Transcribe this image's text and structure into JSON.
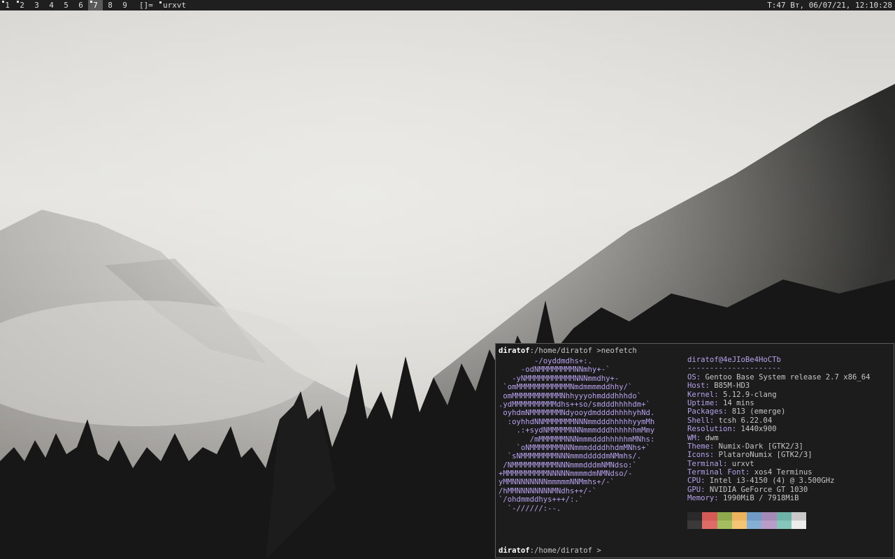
{
  "topbar": {
    "workspaces": [
      {
        "label": "1",
        "active": false,
        "occupied": true
      },
      {
        "label": "2",
        "active": false,
        "occupied": true
      },
      {
        "label": "3",
        "active": false,
        "occupied": false
      },
      {
        "label": "4",
        "active": false,
        "occupied": false
      },
      {
        "label": "5",
        "active": false,
        "occupied": false
      },
      {
        "label": "6",
        "active": false,
        "occupied": false
      },
      {
        "label": "7",
        "active": true,
        "occupied": true
      },
      {
        "label": "8",
        "active": false,
        "occupied": false
      },
      {
        "label": "9",
        "active": false,
        "occupied": false
      }
    ],
    "layout_symbol": "[]=",
    "window_title": "urxvt",
    "status": "T:47 Вт, 06/07/21, 12:10:28"
  },
  "terminal": {
    "prompt_user": "diratof",
    "prompt_path": ":/home/diratof >",
    "command": "neofetch",
    "logo_lines": [
      "        -/oyddmdhs+:.",
      "     -odNMMMMMMMMNNmhy+-`",
      "   -yNMMMMMMMMMMMNNNmmdhy+-",
      " `omMMMMMMMMMMMMNmdmmmmddhhy/`",
      " omMMMMMMMMMMMNhhyyyohmdddhhhdo`",
      ".ydMMMMMMMMMMdhs++so/smdddhhhhdm+`",
      " oyhdmNMMMMMMMNdyooydmddddhhhhyhNd.",
      "  :oyhhdNNMMMMMMMNNNmmdddhhhhhyymMh",
      "    .:+sydNMMMMMNNNmmmdddhhhhhhmMmy",
      "       /mMMMMMMNNNmmmdddhhhhhmMNhs:",
      "    `oNMMMMMMMNNNmmmddddhhdmMNhs+`",
      "  `sNMMMMMMMMNNNmmmdddddmNMmhs/.",
      " /NMMMMMMMMMMNNNmmmdddmNMNdso:`",
      "+MMMMMMMMMMNNNNNmmmmdmNMNdso/-",
      "yMMNNNNNNNNmmmmmNNMmhs+/-`",
      "/hMMNNNNNNNNMNdhs++/-`",
      "`/ohdmmddhys+++/:.`",
      "  `-//////:--."
    ],
    "info_header": "diratof@4eJIoBe4HoCTb",
    "info_separator": "---------------------",
    "info": [
      {
        "key": "OS",
        "value": "Gentoo Base System release 2.7 x86_64"
      },
      {
        "key": "Host",
        "value": "B85M-HD3"
      },
      {
        "key": "Kernel",
        "value": "5.12.9-clang"
      },
      {
        "key": "Uptime",
        "value": "14 mins"
      },
      {
        "key": "Packages",
        "value": "813 (emerge)"
      },
      {
        "key": "Shell",
        "value": "tcsh 6.22.04"
      },
      {
        "key": "Resolution",
        "value": "1440x900"
      },
      {
        "key": "WM",
        "value": "dwm"
      },
      {
        "key": "Theme",
        "value": "Numix-Dark [GTK2/3]"
      },
      {
        "key": "Icons",
        "value": "PlataroNumix [GTK2/3]"
      },
      {
        "key": "Terminal",
        "value": "urxvt"
      },
      {
        "key": "Terminal Font",
        "value": "xos4 Terminus"
      },
      {
        "key": "CPU",
        "value": "Intel i3-4150 (4) @ 3.500GHz"
      },
      {
        "key": "GPU",
        "value": "NVIDIA GeForce GT 1030"
      },
      {
        "key": "Memory",
        "value": "1990MiB / 7918MiB"
      }
    ],
    "palette_row1": [
      "#2a2a2a",
      "#d45a55",
      "#8eaa4c",
      "#eeb35d",
      "#6f9bc6",
      "#a58ab8",
      "#6fb3a8",
      "#c8c8c8"
    ],
    "palette_row2": [
      "#3a3a3a",
      "#e06c67",
      "#a3bd5f",
      "#f5c576",
      "#86afd6",
      "#b89dc9",
      "#86c6bb",
      "#ececec"
    ],
    "final_prompt_user": "diratof",
    "final_prompt_path": ":/home/diratof >"
  }
}
